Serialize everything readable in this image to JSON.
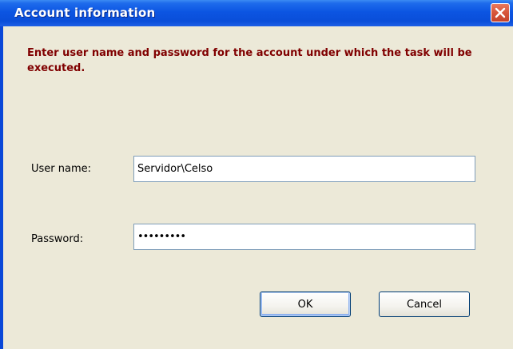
{
  "window": {
    "title": "Account information"
  },
  "message": "Enter user name and password for the account  under which the task will be executed.",
  "form": {
    "username_label": "User name:",
    "username_value": "Servidor\\Celso",
    "password_label": "Password:",
    "password_value": "•••••••••"
  },
  "buttons": {
    "ok_label": "OK",
    "cancel_label": "Cancel"
  },
  "colors": {
    "titlebar": "#0a4ed9",
    "dialog_bg": "#ece9d8",
    "message_text": "#800000",
    "close_button": "#d6553a"
  },
  "icons": {
    "close": "close-icon"
  }
}
